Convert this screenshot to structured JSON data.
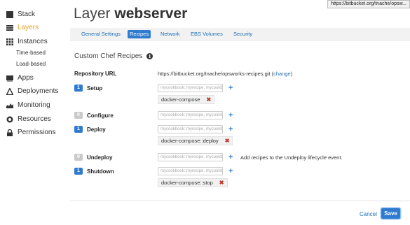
{
  "tooltip_url": "https://bitbucket.org/tnache/opsw...",
  "sidebar": {
    "items": [
      {
        "label": "Stack",
        "icon": "stack-icon"
      },
      {
        "label": "Layers",
        "icon": "layers-icon",
        "active": true
      },
      {
        "label": "Instances",
        "icon": "instances-icon"
      },
      {
        "label": "Apps",
        "icon": "apps-icon"
      },
      {
        "label": "Deployments",
        "icon": "deployments-icon"
      },
      {
        "label": "Monitoring",
        "icon": "monitoring-icon"
      },
      {
        "label": "Resources",
        "icon": "resources-icon"
      },
      {
        "label": "Permissions",
        "icon": "permissions-icon"
      }
    ],
    "sub_items": [
      {
        "label": "Time-based"
      },
      {
        "label": "Load-based"
      }
    ]
  },
  "page": {
    "title_prefix": "Layer",
    "title_name": "webserver"
  },
  "tabs": [
    {
      "label": "General Settings"
    },
    {
      "label": "Recipes",
      "active": true
    },
    {
      "label": "Network"
    },
    {
      "label": "EBS Volumes"
    },
    {
      "label": "Security"
    }
  ],
  "section": {
    "title": "Custom Chef Recipes",
    "repo_label": "Repository URL",
    "repo_url": "https://bitbucket.org/tnache/opsworks-recipes.git",
    "repo_open": "(",
    "change_label": "change",
    "repo_close": ")"
  },
  "placeholder": "mycookbook::myrecipe, mycookbook",
  "events": [
    {
      "name": "Setup",
      "count": "1",
      "chip": "docker-compose"
    },
    {
      "name": "Configure",
      "count": "0"
    },
    {
      "name": "Deploy",
      "count": "1",
      "chip": "docker-compose::deploy"
    },
    {
      "name": "Undeploy",
      "count": "0",
      "hint": "Add recipes to the Undeploy lifecycle event."
    },
    {
      "name": "Shutdown",
      "count": "1",
      "chip": "docker-compose::stop"
    }
  ],
  "footer": {
    "cancel_label": "Cancel",
    "save_label": "Save"
  },
  "colors": {
    "accent": "#2e7bcf",
    "active_nav": "#e9a12b",
    "remove": "#c0392b"
  }
}
